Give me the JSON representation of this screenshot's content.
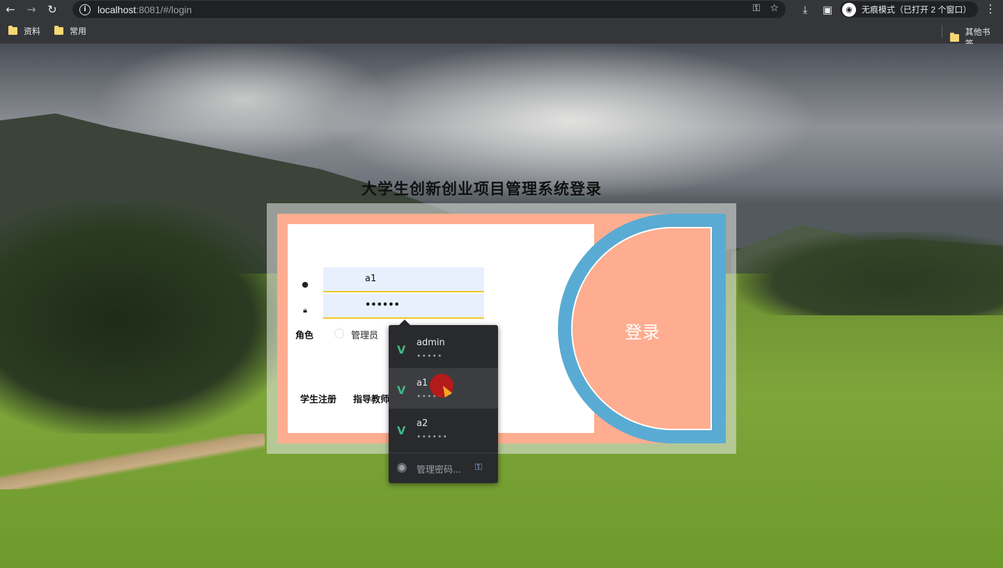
{
  "browser": {
    "url_host": "localhost",
    "url_rest": ":8081/#/login",
    "incognito_text": "无痕模式（已打开 2 个窗口）",
    "icons": [
      "back-icon",
      "forward-icon",
      "reload-icon",
      "info-icon",
      "key-icon",
      "star-icon",
      "download-icon",
      "sidebar-icon",
      "incognito-icon",
      "menu-icon"
    ]
  },
  "bookmarks": {
    "items": [
      "资料",
      "常用"
    ],
    "other": "其他书签"
  },
  "page": {
    "title": "大学生创新创业项目管理系统登录",
    "username_value": "a1",
    "password_value": "••••••",
    "role_label": "角色",
    "role_option": "管理员",
    "register_student": "学生注册",
    "register_teacher": "指导教师",
    "login_button": "登录"
  },
  "autofill": {
    "items": [
      {
        "name": "admin",
        "password": "•••••"
      },
      {
        "name": "a1",
        "password": "••••••"
      },
      {
        "name": "a2",
        "password": "••••••"
      }
    ],
    "manage_label": "管理密码..."
  }
}
